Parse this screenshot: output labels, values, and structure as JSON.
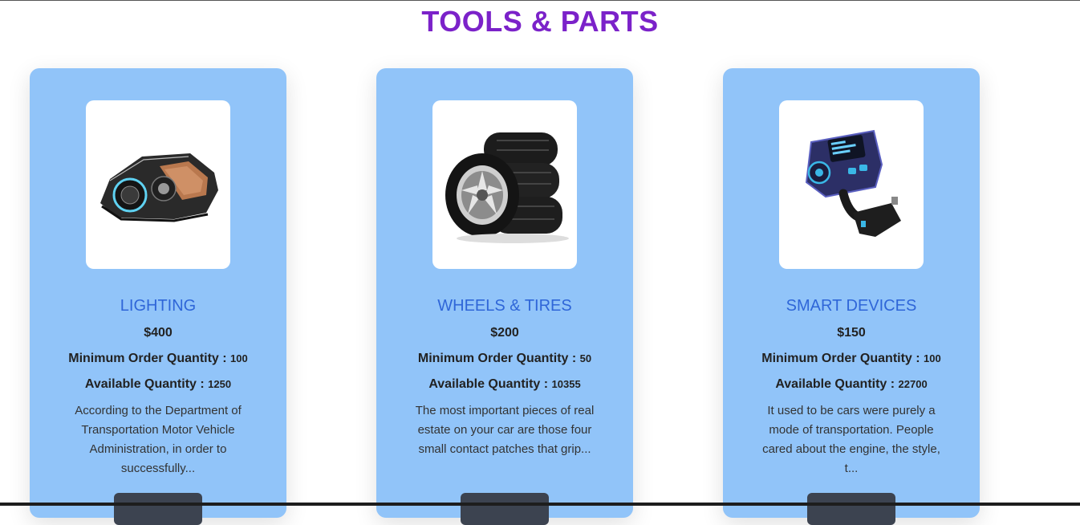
{
  "page": {
    "title": "TOOLS & PARTS"
  },
  "cards": [
    {
      "name": "LIGHTING",
      "price": "$400",
      "moq_label": "Minimum Order Quantity : ",
      "moq_value": "100",
      "aq_label": "Available Quantity : ",
      "aq_value": "1250",
      "description": "According to the Department of Transportation Motor Vehicle Administration, in order to successfully...",
      "image_icon": "headlight-image"
    },
    {
      "name": "WHEELS & TIRES",
      "price": "$200",
      "moq_label": "Minimum Order Quantity : ",
      "moq_value": "50",
      "aq_label": "Available Quantity : ",
      "aq_value": "10355",
      "description": "The most important pieces of real estate on your car are those four small contact patches that grip...",
      "image_icon": "tires-image"
    },
    {
      "name": "SMART DEVICES",
      "price": "$150",
      "moq_label": "Minimum Order Quantity : ",
      "moq_value": "100",
      "aq_label": "Available Quantity : ",
      "aq_value": "22700",
      "description": "It used to be cars were purely a mode of transportation. People cared about the engine, the style, t...",
      "image_icon": "fm-transmitter-image"
    }
  ],
  "colors": {
    "title": "#7b22c9",
    "card_bg": "#91c4f9",
    "name": "#2f66d8",
    "button": "#3c4350"
  }
}
